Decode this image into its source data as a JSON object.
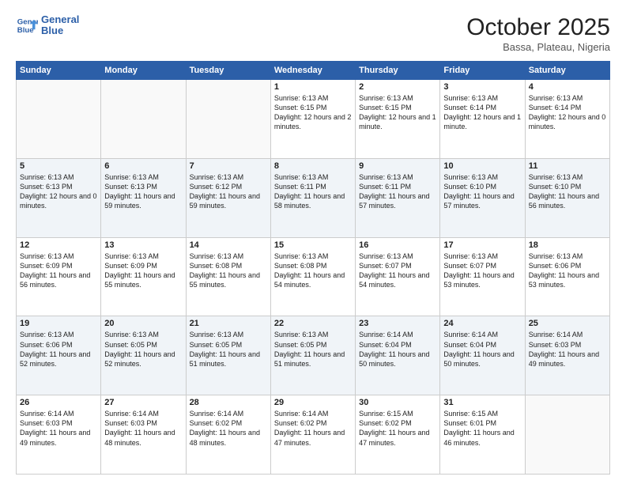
{
  "header": {
    "logo_line1": "General",
    "logo_line2": "Blue",
    "month_year": "October 2025",
    "location": "Bassa, Plateau, Nigeria"
  },
  "weekdays": [
    "Sunday",
    "Monday",
    "Tuesday",
    "Wednesday",
    "Thursday",
    "Friday",
    "Saturday"
  ],
  "weeks": [
    [
      {
        "day": "",
        "info": ""
      },
      {
        "day": "",
        "info": ""
      },
      {
        "day": "",
        "info": ""
      },
      {
        "day": "1",
        "info": "Sunrise: 6:13 AM\nSunset: 6:15 PM\nDaylight: 12 hours and 2 minutes."
      },
      {
        "day": "2",
        "info": "Sunrise: 6:13 AM\nSunset: 6:15 PM\nDaylight: 12 hours and 1 minute."
      },
      {
        "day": "3",
        "info": "Sunrise: 6:13 AM\nSunset: 6:14 PM\nDaylight: 12 hours and 1 minute."
      },
      {
        "day": "4",
        "info": "Sunrise: 6:13 AM\nSunset: 6:14 PM\nDaylight: 12 hours and 0 minutes."
      }
    ],
    [
      {
        "day": "5",
        "info": "Sunrise: 6:13 AM\nSunset: 6:13 PM\nDaylight: 12 hours and 0 minutes."
      },
      {
        "day": "6",
        "info": "Sunrise: 6:13 AM\nSunset: 6:13 PM\nDaylight: 11 hours and 59 minutes."
      },
      {
        "day": "7",
        "info": "Sunrise: 6:13 AM\nSunset: 6:12 PM\nDaylight: 11 hours and 59 minutes."
      },
      {
        "day": "8",
        "info": "Sunrise: 6:13 AM\nSunset: 6:11 PM\nDaylight: 11 hours and 58 minutes."
      },
      {
        "day": "9",
        "info": "Sunrise: 6:13 AM\nSunset: 6:11 PM\nDaylight: 11 hours and 57 minutes."
      },
      {
        "day": "10",
        "info": "Sunrise: 6:13 AM\nSunset: 6:10 PM\nDaylight: 11 hours and 57 minutes."
      },
      {
        "day": "11",
        "info": "Sunrise: 6:13 AM\nSunset: 6:10 PM\nDaylight: 11 hours and 56 minutes."
      }
    ],
    [
      {
        "day": "12",
        "info": "Sunrise: 6:13 AM\nSunset: 6:09 PM\nDaylight: 11 hours and 56 minutes."
      },
      {
        "day": "13",
        "info": "Sunrise: 6:13 AM\nSunset: 6:09 PM\nDaylight: 11 hours and 55 minutes."
      },
      {
        "day": "14",
        "info": "Sunrise: 6:13 AM\nSunset: 6:08 PM\nDaylight: 11 hours and 55 minutes."
      },
      {
        "day": "15",
        "info": "Sunrise: 6:13 AM\nSunset: 6:08 PM\nDaylight: 11 hours and 54 minutes."
      },
      {
        "day": "16",
        "info": "Sunrise: 6:13 AM\nSunset: 6:07 PM\nDaylight: 11 hours and 54 minutes."
      },
      {
        "day": "17",
        "info": "Sunrise: 6:13 AM\nSunset: 6:07 PM\nDaylight: 11 hours and 53 minutes."
      },
      {
        "day": "18",
        "info": "Sunrise: 6:13 AM\nSunset: 6:06 PM\nDaylight: 11 hours and 53 minutes."
      }
    ],
    [
      {
        "day": "19",
        "info": "Sunrise: 6:13 AM\nSunset: 6:06 PM\nDaylight: 11 hours and 52 minutes."
      },
      {
        "day": "20",
        "info": "Sunrise: 6:13 AM\nSunset: 6:05 PM\nDaylight: 11 hours and 52 minutes."
      },
      {
        "day": "21",
        "info": "Sunrise: 6:13 AM\nSunset: 6:05 PM\nDaylight: 11 hours and 51 minutes."
      },
      {
        "day": "22",
        "info": "Sunrise: 6:13 AM\nSunset: 6:05 PM\nDaylight: 11 hours and 51 minutes."
      },
      {
        "day": "23",
        "info": "Sunrise: 6:14 AM\nSunset: 6:04 PM\nDaylight: 11 hours and 50 minutes."
      },
      {
        "day": "24",
        "info": "Sunrise: 6:14 AM\nSunset: 6:04 PM\nDaylight: 11 hours and 50 minutes."
      },
      {
        "day": "25",
        "info": "Sunrise: 6:14 AM\nSunset: 6:03 PM\nDaylight: 11 hours and 49 minutes."
      }
    ],
    [
      {
        "day": "26",
        "info": "Sunrise: 6:14 AM\nSunset: 6:03 PM\nDaylight: 11 hours and 49 minutes."
      },
      {
        "day": "27",
        "info": "Sunrise: 6:14 AM\nSunset: 6:03 PM\nDaylight: 11 hours and 48 minutes."
      },
      {
        "day": "28",
        "info": "Sunrise: 6:14 AM\nSunset: 6:02 PM\nDaylight: 11 hours and 48 minutes."
      },
      {
        "day": "29",
        "info": "Sunrise: 6:14 AM\nSunset: 6:02 PM\nDaylight: 11 hours and 47 minutes."
      },
      {
        "day": "30",
        "info": "Sunrise: 6:15 AM\nSunset: 6:02 PM\nDaylight: 11 hours and 47 minutes."
      },
      {
        "day": "31",
        "info": "Sunrise: 6:15 AM\nSunset: 6:01 PM\nDaylight: 11 hours and 46 minutes."
      },
      {
        "day": "",
        "info": ""
      }
    ]
  ]
}
